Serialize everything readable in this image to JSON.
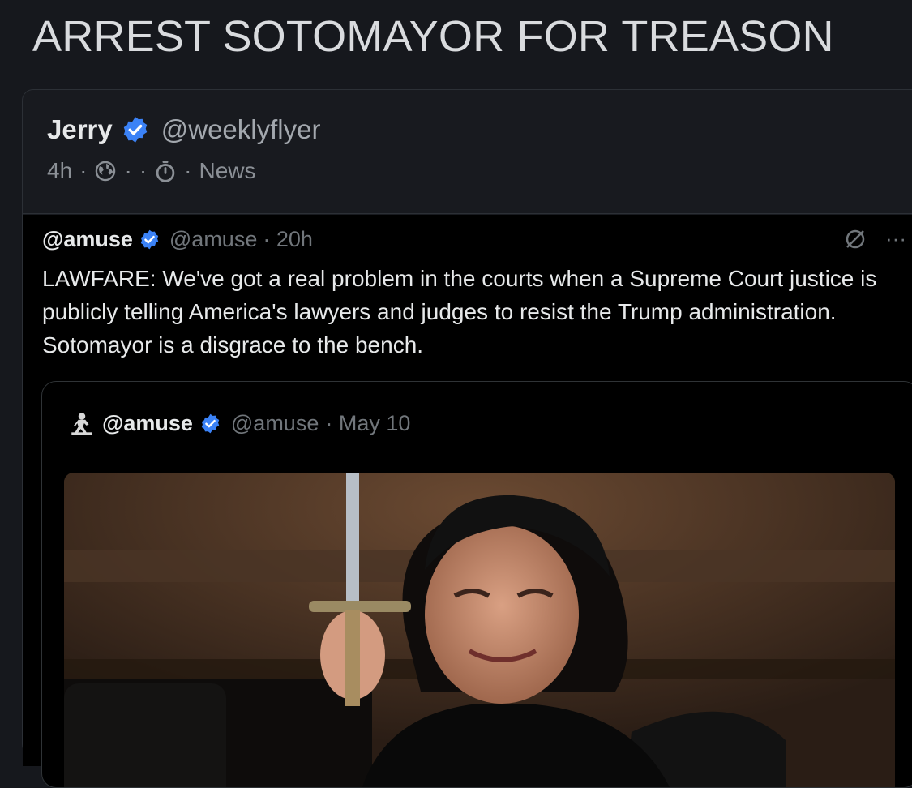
{
  "headline": "ARREST SOTOMAYOR FOR TREASON",
  "post": {
    "author_name": "Jerry",
    "author_handle": "@weeklyflyer",
    "age": "4h",
    "sep": "·",
    "category": "News"
  },
  "tweet": {
    "name": "@amuse",
    "handle": "@amuse",
    "time": "· 20h",
    "more": "···",
    "text": "LAWFARE: We've got a real problem in the courts when a Supreme Court justice is publicly telling America's lawyers and judges to resist the Trump administration. Sotomayor is a disgrace to the bench."
  },
  "quote": {
    "name": "@amuse",
    "handle": "@amuse",
    "time": "· May 10"
  },
  "colors": {
    "verified": "#3b82f6",
    "background": "#16181d",
    "tweet_background": "#000000"
  }
}
